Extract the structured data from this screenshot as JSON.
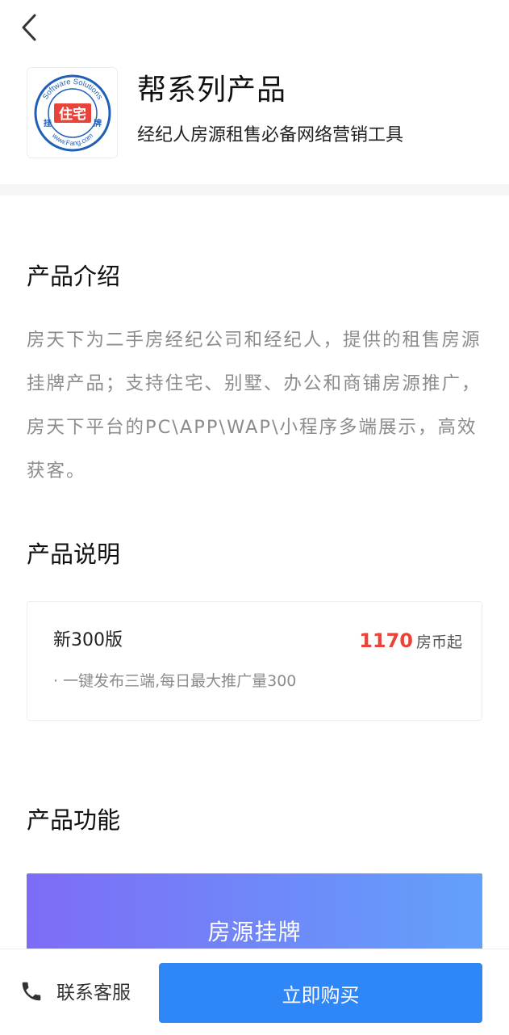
{
  "header": {
    "title": "帮系列产品",
    "subtitle": "经纪人房源租售必备网络营销工具",
    "logo": {
      "ring_text_top": "Software Solutions",
      "ring_text_bottom": "www.Fang.com",
      "center_text": "住宅",
      "left_text": "挂",
      "right_text": "牌",
      "colors": {
        "ring": "#1f5fb7",
        "center_box": "#e8443a"
      }
    }
  },
  "intro": {
    "title": "产品介绍",
    "body": "房天下为二手房经纪公司和经纪人，提供的租售房源挂牌产品；支持住宅、别墅、办公和商铺房源推广，房天下平台的PC\\APP\\WAP\\小程序多端展示，高效获客。"
  },
  "spec": {
    "title": "产品说明",
    "plan": {
      "name": "新300版",
      "price": "1170",
      "price_unit": "房币起",
      "desc": "· 一键发布三端,每日最大推广量300"
    }
  },
  "features": {
    "title": "产品功能",
    "banner_label": "房源挂牌"
  },
  "footer": {
    "service_label": "联系客服",
    "buy_label": "立即购买"
  },
  "icons": {
    "back": "back-chevron-icon",
    "phone": "phone-icon"
  },
  "colors": {
    "accent": "#2f86f6",
    "price": "#e8443a",
    "banner_start": "#7e6cf6",
    "banner_end": "#62a1fb"
  }
}
